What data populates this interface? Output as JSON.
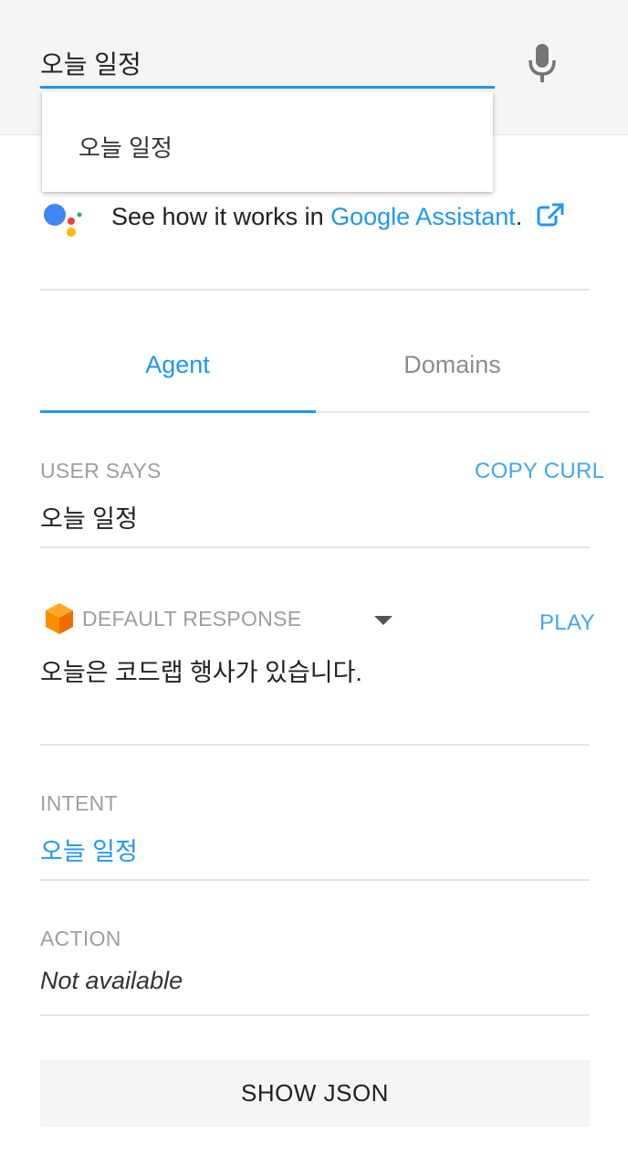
{
  "search": {
    "value": "오늘 일정",
    "suggestion": "오늘 일정"
  },
  "assistant": {
    "prefix": "See how it works in ",
    "link": "Google Assistant",
    "suffix": "."
  },
  "tabs": {
    "agent": "Agent",
    "domains": "Domains"
  },
  "user_says": {
    "label": "USER SAYS",
    "copy_curl": "COPY CURL",
    "value": "오늘 일정"
  },
  "response": {
    "label": "DEFAULT RESPONSE",
    "play": "PLAY",
    "value": "오늘은 코드랩 행사가 있습니다."
  },
  "intent": {
    "label": "INTENT",
    "value": "오늘 일정"
  },
  "action": {
    "label": "ACTION",
    "value": "Not available"
  },
  "show_json": "SHOW JSON",
  "colors": {
    "accent": "#2196f3",
    "response_icon": "#f57c00"
  }
}
